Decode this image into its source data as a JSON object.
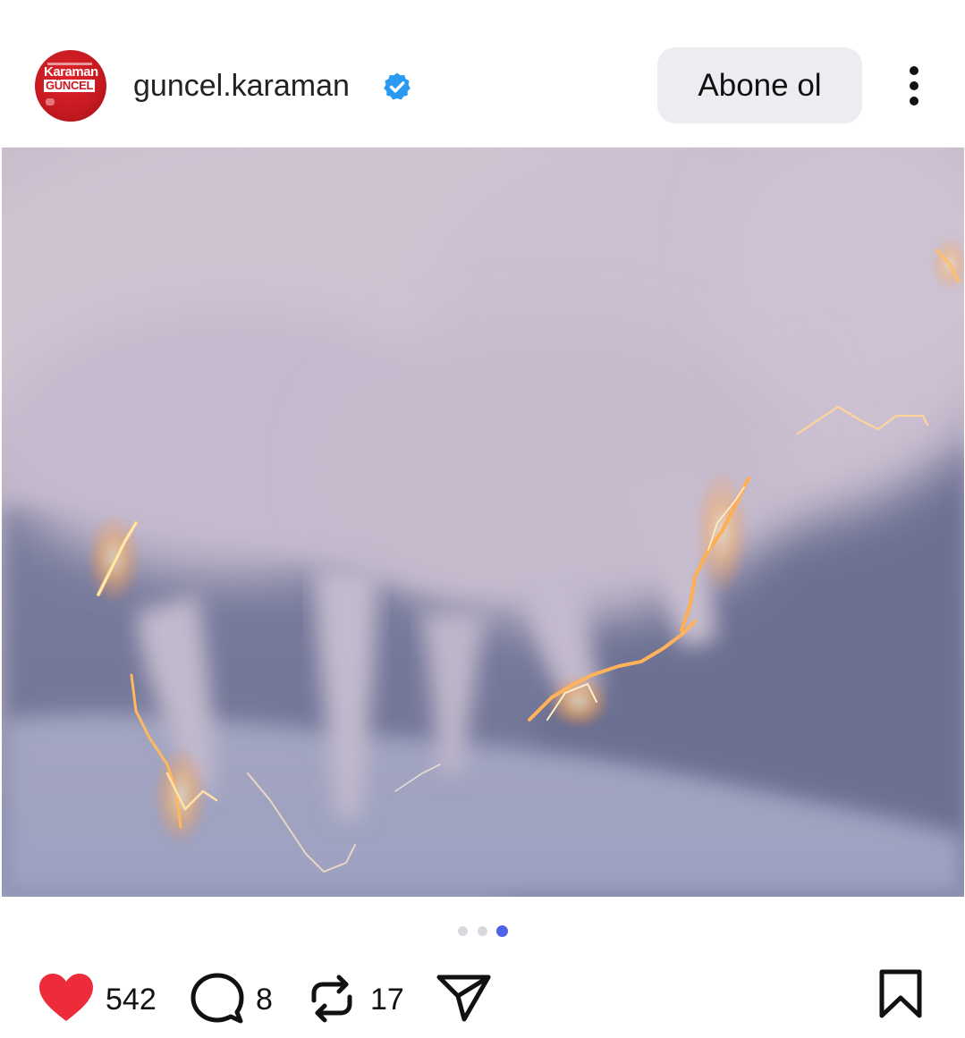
{
  "header": {
    "avatar_brand_top": "Karaman",
    "avatar_brand_bottom": "GÜNCEL",
    "username": "guncel.karaman",
    "verified_icon": "verified-badge-icon",
    "subscribe_label": "Abone ol",
    "more_icon": "vertical-ellipsis-icon"
  },
  "media": {
    "pagination": {
      "total": 3,
      "active_index": 3
    }
  },
  "actions": {
    "like": {
      "icon": "heart-icon",
      "count": "542",
      "color": "#ee2b3b"
    },
    "comment": {
      "icon": "comment-bubble-icon",
      "count": "8"
    },
    "repost": {
      "icon": "repost-icon",
      "count": "17"
    },
    "share": {
      "icon": "send-icon"
    },
    "save": {
      "icon": "bookmark-icon"
    }
  },
  "colors": {
    "verified": "#2a9af1",
    "pagination_active": "#4f63e6",
    "pagination_inactive": "#d8d9de",
    "subscribe_bg": "#ebedf1"
  }
}
